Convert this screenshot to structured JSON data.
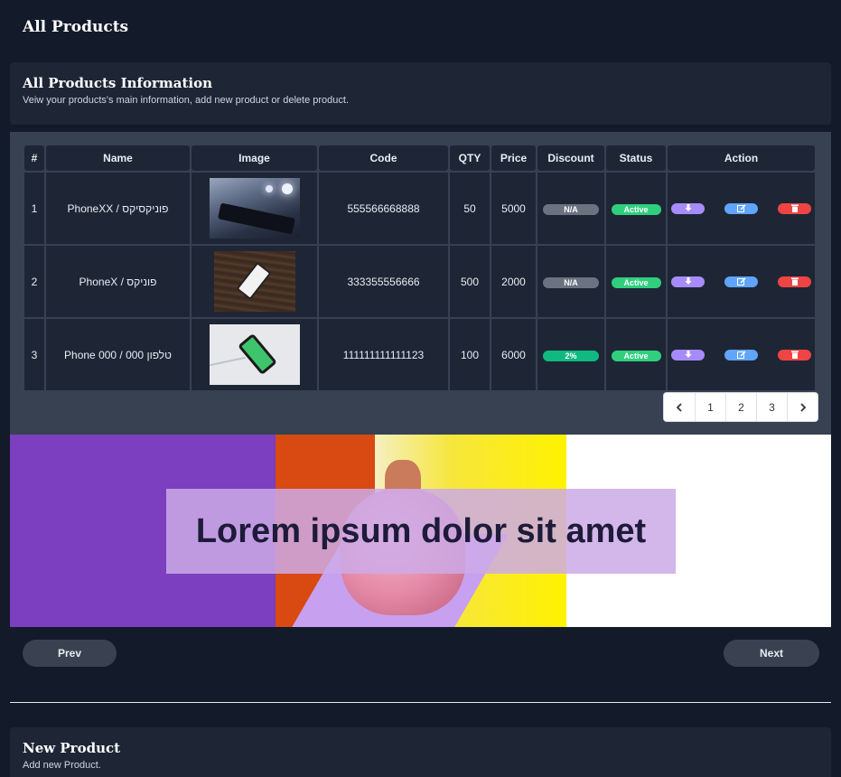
{
  "page": {
    "title": "All Products"
  },
  "info": {
    "title": "All Products Information",
    "subtitle": "Veiw your products's main information, add new product or delete product."
  },
  "table": {
    "headers": [
      "#",
      "Name",
      "Image",
      "Code",
      "QTY",
      "Price",
      "Discount",
      "Status",
      "Action"
    ],
    "rows": [
      {
        "num": "1",
        "name": "PhoneXX / פוניקסיקס",
        "code": "555566668888",
        "qty": "50",
        "price": "5000",
        "discount": "N/A",
        "status": "Active"
      },
      {
        "num": "2",
        "name": "PhoneX / פוניקס",
        "code": "333355556666",
        "qty": "500",
        "price": "2000",
        "discount": "N/A",
        "status": "Active"
      },
      {
        "num": "3",
        "name": "Phone 000 / 000 טלפון",
        "code": "111111111111123",
        "qty": "100",
        "price": "6000",
        "discount": "2%",
        "status": "Active"
      }
    ]
  },
  "pagination": {
    "pages": [
      "1",
      "2",
      "3"
    ]
  },
  "banner": {
    "text": "Lorem ipsum dolor sit amet"
  },
  "nav": {
    "prev": "Prev",
    "next": "Next"
  },
  "new_product": {
    "title": "New Product",
    "subtitle": "Add new Product."
  },
  "colors": {
    "background": "#131a2a",
    "card": "#1e2636",
    "active": "#2fcf7d",
    "na": "#6b7280",
    "download": "#a78bfa",
    "edit": "#60a5fa",
    "delete": "#ef4444"
  },
  "icons": {
    "download": "download-icon",
    "edit": "edit-icon",
    "delete": "trash-icon",
    "prev": "chevron-left-icon",
    "next": "chevron-right-icon"
  }
}
